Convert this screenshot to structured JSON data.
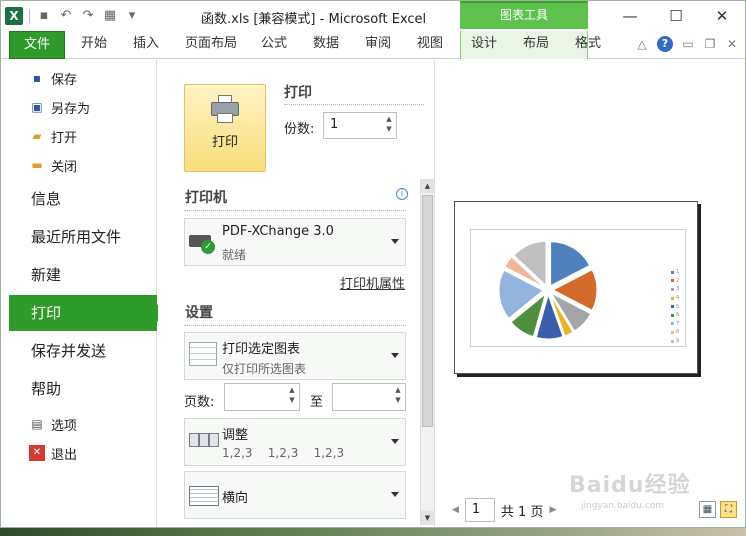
{
  "window": {
    "title": "函数.xls  [兼容模式]  -  Microsoft Excel",
    "context_tab_group": "图表工具",
    "minimize": "—",
    "maximize": "☐",
    "close": "✕"
  },
  "qat": {
    "app_icon": "X"
  },
  "ribbon_tabs": [
    "文件",
    "开始",
    "插入",
    "页面布局",
    "公式",
    "数据",
    "审阅",
    "视图",
    "设计",
    "布局",
    "格式"
  ],
  "ribbon_right": {
    "help": "?"
  },
  "left_menu": {
    "small_top": [
      {
        "label": "保存",
        "icon": "save-icon"
      },
      {
        "label": "另存为",
        "icon": "save-as-icon"
      },
      {
        "label": "打开",
        "icon": "open-folder-icon"
      },
      {
        "label": "关闭",
        "icon": "close-folder-icon"
      }
    ],
    "big": [
      "信息",
      "最近所用文件",
      "新建",
      "打印",
      "保存并发送",
      "帮助"
    ],
    "active": "打印",
    "small_bottom": [
      {
        "label": "选项",
        "icon": "options-icon"
      },
      {
        "label": "退出",
        "icon": "exit-icon"
      }
    ]
  },
  "print_pane": {
    "print_button": "打印",
    "print_heading": "打印",
    "copies_label": "份数:",
    "copies_value": "1",
    "printer_heading": "打印机",
    "printer_name": "PDF-XChange 3.0",
    "printer_status": "就绪",
    "printer_props_link": "打印机属性",
    "settings_heading": "设置",
    "print_what": "打印选定图表",
    "print_what_sub": "仅打印所选图表",
    "pages_label": "页数:",
    "pages_to_label": "至",
    "collate": "调整",
    "collate_sub": "1,2,3    1,2,3    1,2,3",
    "orientation": "横向"
  },
  "preview": {
    "current_page": "1",
    "page_total_label": "共 1 页"
  },
  "chart_data": {
    "type": "pie",
    "categories": [
      "1",
      "2",
      "3",
      "4",
      "5",
      "6",
      "7",
      "8",
      "9"
    ],
    "values": [
      16,
      14,
      8,
      3,
      9,
      9,
      17,
      4,
      12
    ],
    "colors": [
      "#4f81bd",
      "#d46a2a",
      "#a5a5a5",
      "#e9b521",
      "#3b5fae",
      "#4e8e3d",
      "#92b4dd",
      "#f2b49a",
      "#c0c0c0"
    ],
    "exploded": true,
    "legend_position": "right"
  },
  "watermark": {
    "text": "Baidu经验",
    "sub": "jingyan.baidu.com"
  }
}
